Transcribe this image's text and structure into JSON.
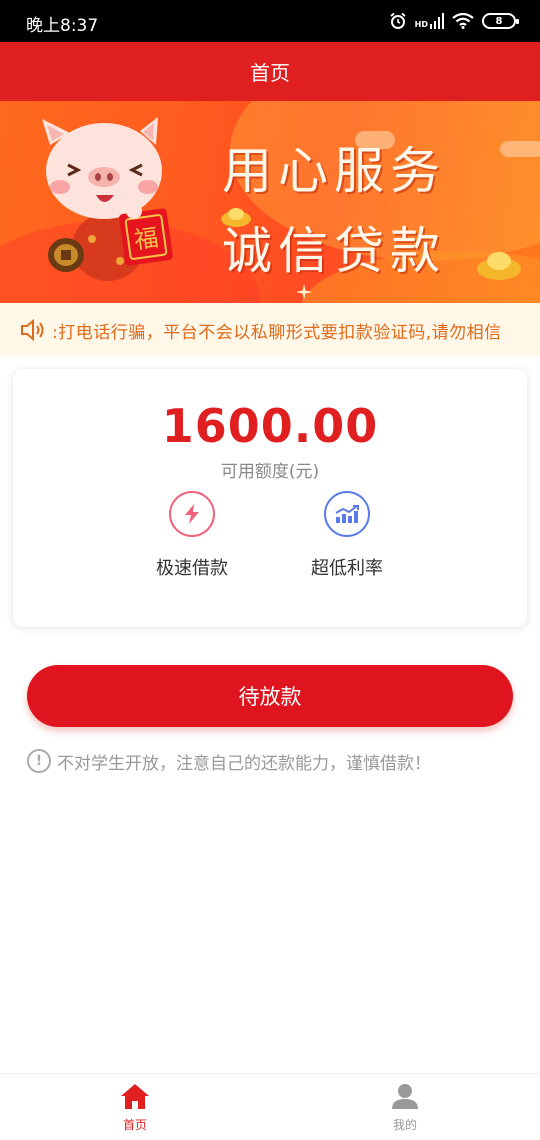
{
  "status_bar": {
    "time": "晚上8:37",
    "hd_label": "HD",
    "battery": "8"
  },
  "header": {
    "title": "首页"
  },
  "banner": {
    "line1": "用心服务",
    "line2": "诚信贷款",
    "badge_char": "福"
  },
  "notice": {
    "text": ":打电话行骗，平台不会以私聊形式要扣款验证码,请勿相信"
  },
  "card": {
    "amount": "1600.00",
    "amount_label": "可用额度(元)",
    "features": [
      {
        "label": "极速借款",
        "icon": "lightning-icon",
        "color": "#f0617a"
      },
      {
        "label": "超低利率",
        "icon": "chart-up-icon",
        "color": "#5b7be8"
      }
    ]
  },
  "main_button": {
    "label": "待放款"
  },
  "warning": {
    "icon_glyph": "!",
    "text": "不对学生开放，注意自己的还款能力，谨慎借款！"
  },
  "tabbar": {
    "tabs": [
      {
        "label": "首页",
        "icon": "home-icon",
        "active": true
      },
      {
        "label": "我的",
        "icon": "user-icon",
        "active": false
      }
    ]
  },
  "colors": {
    "brand_red": "#e01f20",
    "notice_orange": "#e06a1a",
    "notice_bg": "#fff7e8"
  }
}
